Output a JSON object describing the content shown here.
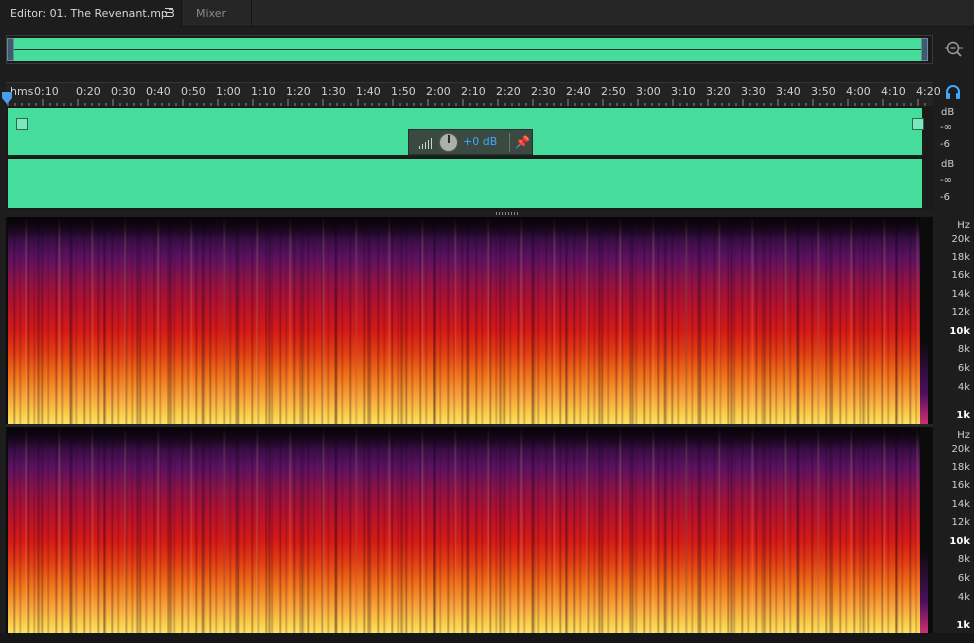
{
  "tabs": {
    "editor_label": "Editor: 01. The Revenant.mp3",
    "mixer_label": "Mixer"
  },
  "ruler": {
    "labels": [
      "hms",
      "0:10",
      "0:20",
      "0:30",
      "0:40",
      "0:50",
      "1:00",
      "1:10",
      "1:20",
      "1:30",
      "1:40",
      "1:50",
      "2:00",
      "2:10",
      "2:20",
      "2:30",
      "2:40",
      "2:50",
      "3:00",
      "3:10",
      "3:20",
      "3:30",
      "3:40",
      "3:50",
      "4:00",
      "4:10",
      "4:20"
    ]
  },
  "waveform": {
    "channels": [
      {
        "db_unit": "dB",
        "db_inf": "-∞",
        "db_minus6": "-6"
      },
      {
        "db_unit": "dB",
        "db_inf": "-∞",
        "db_minus6": "-6"
      }
    ]
  },
  "hud": {
    "volume_value": "+0 dB"
  },
  "spectral": {
    "unit": "Hz",
    "ticks": [
      "20k",
      "18k",
      "16k",
      "14k",
      "12k",
      "10k",
      "8k",
      "6k",
      "4k",
      "1k"
    ]
  },
  "colors": {
    "waveform": "#45dc9c",
    "accent": "#3da9ff",
    "background": "#1d1d1d"
  },
  "icons": {
    "zoom": "zoom-out-icon",
    "headphones": "headphones-icon",
    "pin": "pin-icon",
    "tab_menu": "menu-icon"
  }
}
